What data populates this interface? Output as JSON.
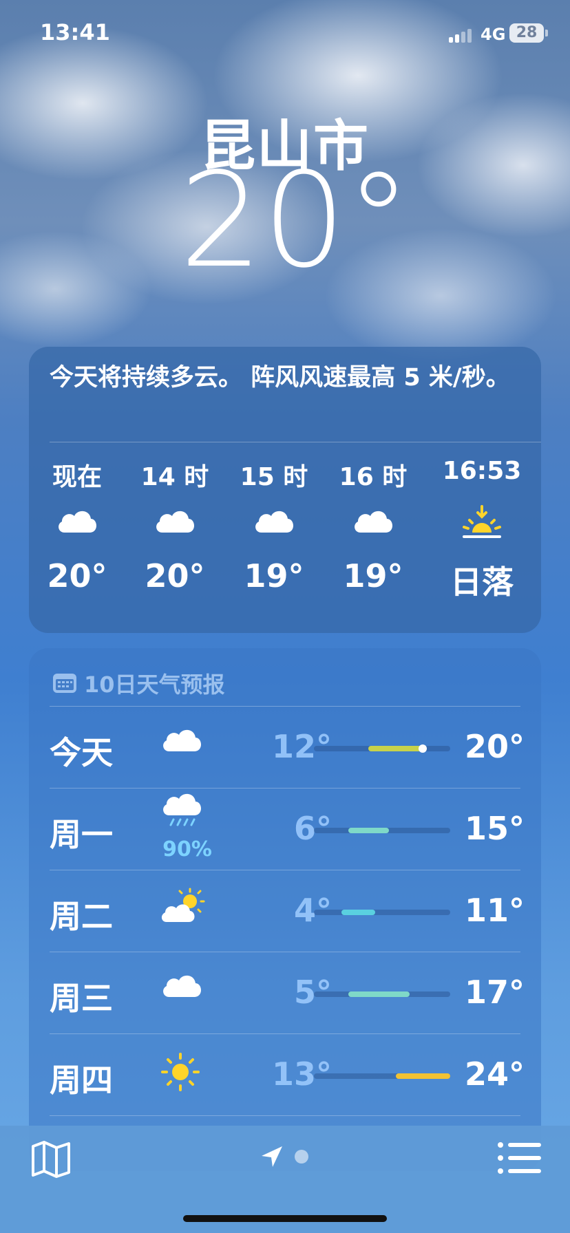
{
  "status_bar": {
    "time": "13:41",
    "network": "4G",
    "battery": "28"
  },
  "location": {
    "city": "昆山市",
    "current_temp": "20°"
  },
  "hourly": {
    "summary": "今天将持续多云。 阵风风速最高 5 米/秒。",
    "items": [
      {
        "label": "现在",
        "icon": "cloud-icon",
        "temp": "20°"
      },
      {
        "label": "14 时",
        "icon": "cloud-icon",
        "temp": "20°"
      },
      {
        "label": "15 时",
        "icon": "cloud-icon",
        "temp": "19°"
      },
      {
        "label": "16 时",
        "icon": "cloud-icon",
        "temp": "19°"
      },
      {
        "label": "16:53",
        "icon": "sunset-icon",
        "temp": "日落"
      }
    ]
  },
  "daily": {
    "header": "10日天气预报",
    "range": [
      4,
      24
    ],
    "days": [
      {
        "day": "今天",
        "icon": "cloud-icon",
        "precip": "",
        "low": "12°",
        "high": "20°",
        "low_val": 12,
        "high_val": 20,
        "current_val": 20,
        "bar_color": "#c7d24a"
      },
      {
        "day": "周一",
        "icon": "rain-icon",
        "precip": "90%",
        "low": "6°",
        "high": "15°",
        "low_val": 9,
        "high_val": 15,
        "bar_color": "#7fd9c8"
      },
      {
        "day": "周二",
        "icon": "partly-sunny-icon",
        "precip": "",
        "low": "4°",
        "high": "11°",
        "low_val": 8,
        "high_val": 13,
        "bar_color": "#5ad0e0"
      },
      {
        "day": "周三",
        "icon": "cloud-icon",
        "precip": "",
        "low": "5°",
        "high": "17°",
        "low_val": 9,
        "high_val": 18,
        "bar_color": "#7fd9c8"
      },
      {
        "day": "周四",
        "icon": "sun-icon",
        "precip": "",
        "low": "13°",
        "high": "24°",
        "low_val": 16,
        "high_val": 24,
        "bar_color": "#f2c233"
      }
    ]
  },
  "toolbar": {
    "map_icon": "map-icon",
    "location_icon": "location-arrow-icon",
    "list_icon": "list-icon"
  }
}
